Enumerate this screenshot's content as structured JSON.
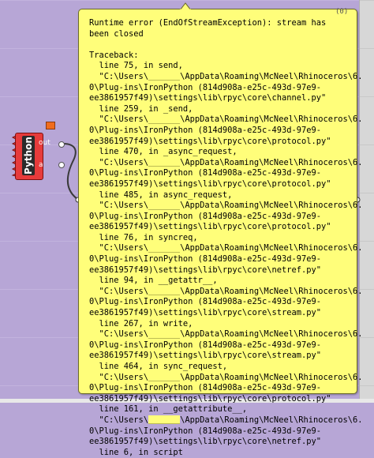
{
  "component": {
    "name": "Python",
    "output_param": "out",
    "input_param": "a",
    "output_index": "0"
  },
  "balloon": {
    "counter": "(0)",
    "lines": [
      "Runtime error (EndOfStreamException): stream has",
      "been closed",
      "",
      "Traceback:",
      "  line 75, in send,",
      "  \"C:\\Users\\[REDACTED]\\AppData\\Roaming\\McNeel\\Rhinoceros\\6.",
      "0\\Plug-ins\\IronPython (814d908a-e25c-493d-97e9-",
      "ee3861957f49)\\settings\\lib\\rpyc\\core\\channel.py\"",
      "  line 259, in _send,",
      "  \"C:\\Users\\[REDACTED]\\AppData\\Roaming\\McNeel\\Rhinoceros\\6.",
      "0\\Plug-ins\\IronPython (814d908a-e25c-493d-97e9-",
      "ee3861957f49)\\settings\\lib\\rpyc\\core\\protocol.py\"",
      "  line 470, in _async_request,",
      "  \"C:\\Users\\[REDACTED]\\AppData\\Roaming\\McNeel\\Rhinoceros\\6.",
      "0\\Plug-ins\\IronPython (814d908a-e25c-493d-97e9-",
      "ee3861957f49)\\settings\\lib\\rpyc\\core\\protocol.py\"",
      "  line 485, in async_request,",
      "  \"C:\\Users\\[REDACTED]\\AppData\\Roaming\\McNeel\\Rhinoceros\\6.",
      "0\\Plug-ins\\IronPython (814d908a-e25c-493d-97e9-",
      "ee3861957f49)\\settings\\lib\\rpyc\\core\\protocol.py\"",
      "  line 76, in syncreq,",
      "  \"C:\\Users\\[REDACTED]\\AppData\\Roaming\\McNeel\\Rhinoceros\\6.",
      "0\\Plug-ins\\IronPython (814d908a-e25c-493d-97e9-",
      "ee3861957f49)\\settings\\lib\\rpyc\\core\\netref.py\"",
      "  line 94, in __getattr__,",
      "  \"C:\\Users\\[REDACTED]\\AppData\\Roaming\\McNeel\\Rhinoceros\\6.",
      "0\\Plug-ins\\IronPython (814d908a-e25c-493d-97e9-",
      "ee3861957f49)\\settings\\lib\\rpyc\\core\\stream.py\"",
      "  line 267, in write,",
      "  \"C:\\Users\\[REDACTED]\\AppData\\Roaming\\McNeel\\Rhinoceros\\6.",
      "0\\Plug-ins\\IronPython (814d908a-e25c-493d-97e9-",
      "ee3861957f49)\\settings\\lib\\rpyc\\core\\stream.py\"",
      "  line 464, in sync_request,",
      "  \"C:\\Users\\[REDACTED]\\AppData\\Roaming\\McNeel\\Rhinoceros\\6.",
      "0\\Plug-ins\\IronPython (814d908a-e25c-493d-97e9-",
      "ee3861957f49)\\settings\\lib\\rpyc\\core\\protocol.py\"",
      "  line 161, in __getattribute__,",
      "  \"C:\\Users\\[REDACTED]\\AppData\\Roaming\\McNeel\\Rhinoceros\\6.",
      "0\\Plug-ins\\IronPython (814d908a-e25c-493d-97e9-",
      "ee3861957f49)\\settings\\lib\\rpyc\\core\\netref.py\"",
      "  line 6, in script"
    ]
  },
  "colors": {
    "canvas": "#b7a6d6",
    "balloon": "#fffe7a",
    "component": "#e73b3b",
    "component_label_bg": "#2b2b2b",
    "wire": "#3a3a3a"
  }
}
